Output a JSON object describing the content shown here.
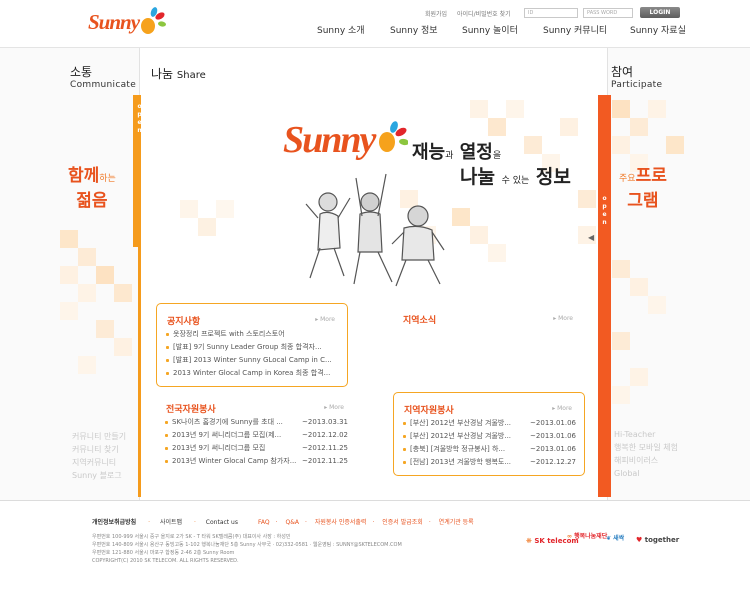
{
  "brand": {
    "logo_text": "Sunny"
  },
  "header": {
    "util_links": [
      "회원가입",
      "아이디/비밀번호 찾기"
    ],
    "id_placeholder": "ID",
    "pw_placeholder": "PASS WORD",
    "login_label": "LOGIN",
    "gnb": [
      "Sunny 소개",
      "Sunny 정보",
      "Sunny 놀이터",
      "Sunny 커뮤니티",
      "Sunny 자료실"
    ]
  },
  "left_panel": {
    "title_kr": "소통",
    "title_en": "Communicate",
    "open_label": "open",
    "tagline_top": "함께",
    "tagline_small": "하는",
    "tagline_bottom": "젊음",
    "links": [
      "커뮤니티 만들기",
      "커뮤니티 찾기",
      "지역커뮤니티",
      "Sunny 블로그"
    ]
  },
  "center_panel": {
    "title_kr": "나눔",
    "title_en": "Share",
    "hero": {
      "logo": "Sunny",
      "line1_a": "재능",
      "line1_b": "과",
      "line1_c": "열정",
      "line1_d": "을",
      "line2_a": "나눌",
      "line2_b": "수 있는",
      "line2_c": "정보"
    }
  },
  "right_panel": {
    "title_kr": "참여",
    "title_en": "Participate",
    "open_label": "open",
    "tagline_small": "주요",
    "tagline_top": "프로",
    "tagline_bottom": "그램",
    "links": [
      "Hi-Teacher",
      "행복한 모바일 체험",
      "해피비이러스",
      "Global"
    ]
  },
  "boxes": {
    "notice": {
      "title": "공지사항",
      "more": "More",
      "items": [
        {
          "text": "옷장정리 프로젝트 with 스토리스토어"
        },
        {
          "text": "[발표] 9기 Sunny Leader Group 최종 합격자..."
        },
        {
          "text": "[발표] 2013 Winter Sunny GLocal Camp in C..."
        },
        {
          "text": "2013 Winter Glocal Camp in Korea 최종 합격..."
        }
      ]
    },
    "local_news": {
      "title": "지역소식",
      "more": "More"
    },
    "national": {
      "title": "전국자원봉사",
      "more": "More",
      "items": [
        {
          "text": "SK나이츠 홈경기에 Sunny를 초대 ...",
          "date": "~2013.03.31"
        },
        {
          "text": "2013년 9기 써니리더그룹 모집(제...",
          "date": "~2012.12.02"
        },
        {
          "text": "2013년 9기 써니리더그룹 모집",
          "date": "~2012.11.25"
        },
        {
          "text": "2013년 Winter Glocal Camp 참가자...",
          "date": "~2012.11.25"
        }
      ]
    },
    "regional": {
      "title": "지역자원봉사",
      "more": "More",
      "items": [
        {
          "text": "[부산] 2012년 부산경남 겨울방...",
          "date": "~2013.01.06"
        },
        {
          "text": "[부산] 2012년 부산경남 겨울방...",
          "date": "~2013.01.06"
        },
        {
          "text": "[충북] [겨울방학 정규봉사] 하...",
          "date": "~2013.01.06"
        },
        {
          "text": "[전남] 2013년 겨울방학 행복도...",
          "date": "~2012.12.27"
        }
      ]
    }
  },
  "footer": {
    "links": [
      "개인정보취급방침",
      "사이트맵",
      "Contact us"
    ],
    "links2": [
      "FAQ",
      "Q&A",
      "자원봉사 인증서출력",
      "인증서 발급조회",
      "연계기관 등록"
    ],
    "address_lines": [
      "우편번호 100-999 서울시 중구 을지로 2가 SK - T 타워 SK텔레콤(주) 대표이사 사장 : 하성민",
      "우편번호 140-809 서울시 용산구 동빙고동 1-102 행복나눔재단 5층 Sunny 사무국 · 02)332-0581 · 웹운영팀 : SUNNY@SKTELECOM.COM",
      "우편번호 121-880 서울시 마포구 합정동 2-46 2층 Sunny Room",
      "COPYRIGHT(C) 2010 SK TELECOM. ALL RIGHTS RESERVED."
    ],
    "partners": [
      "SK telecom",
      "행복나눔재단",
      "새싹",
      "together"
    ]
  },
  "colors": {
    "accent": "#e8531e",
    "orange": "#f59b1c",
    "red_orange": "#f25a22"
  }
}
